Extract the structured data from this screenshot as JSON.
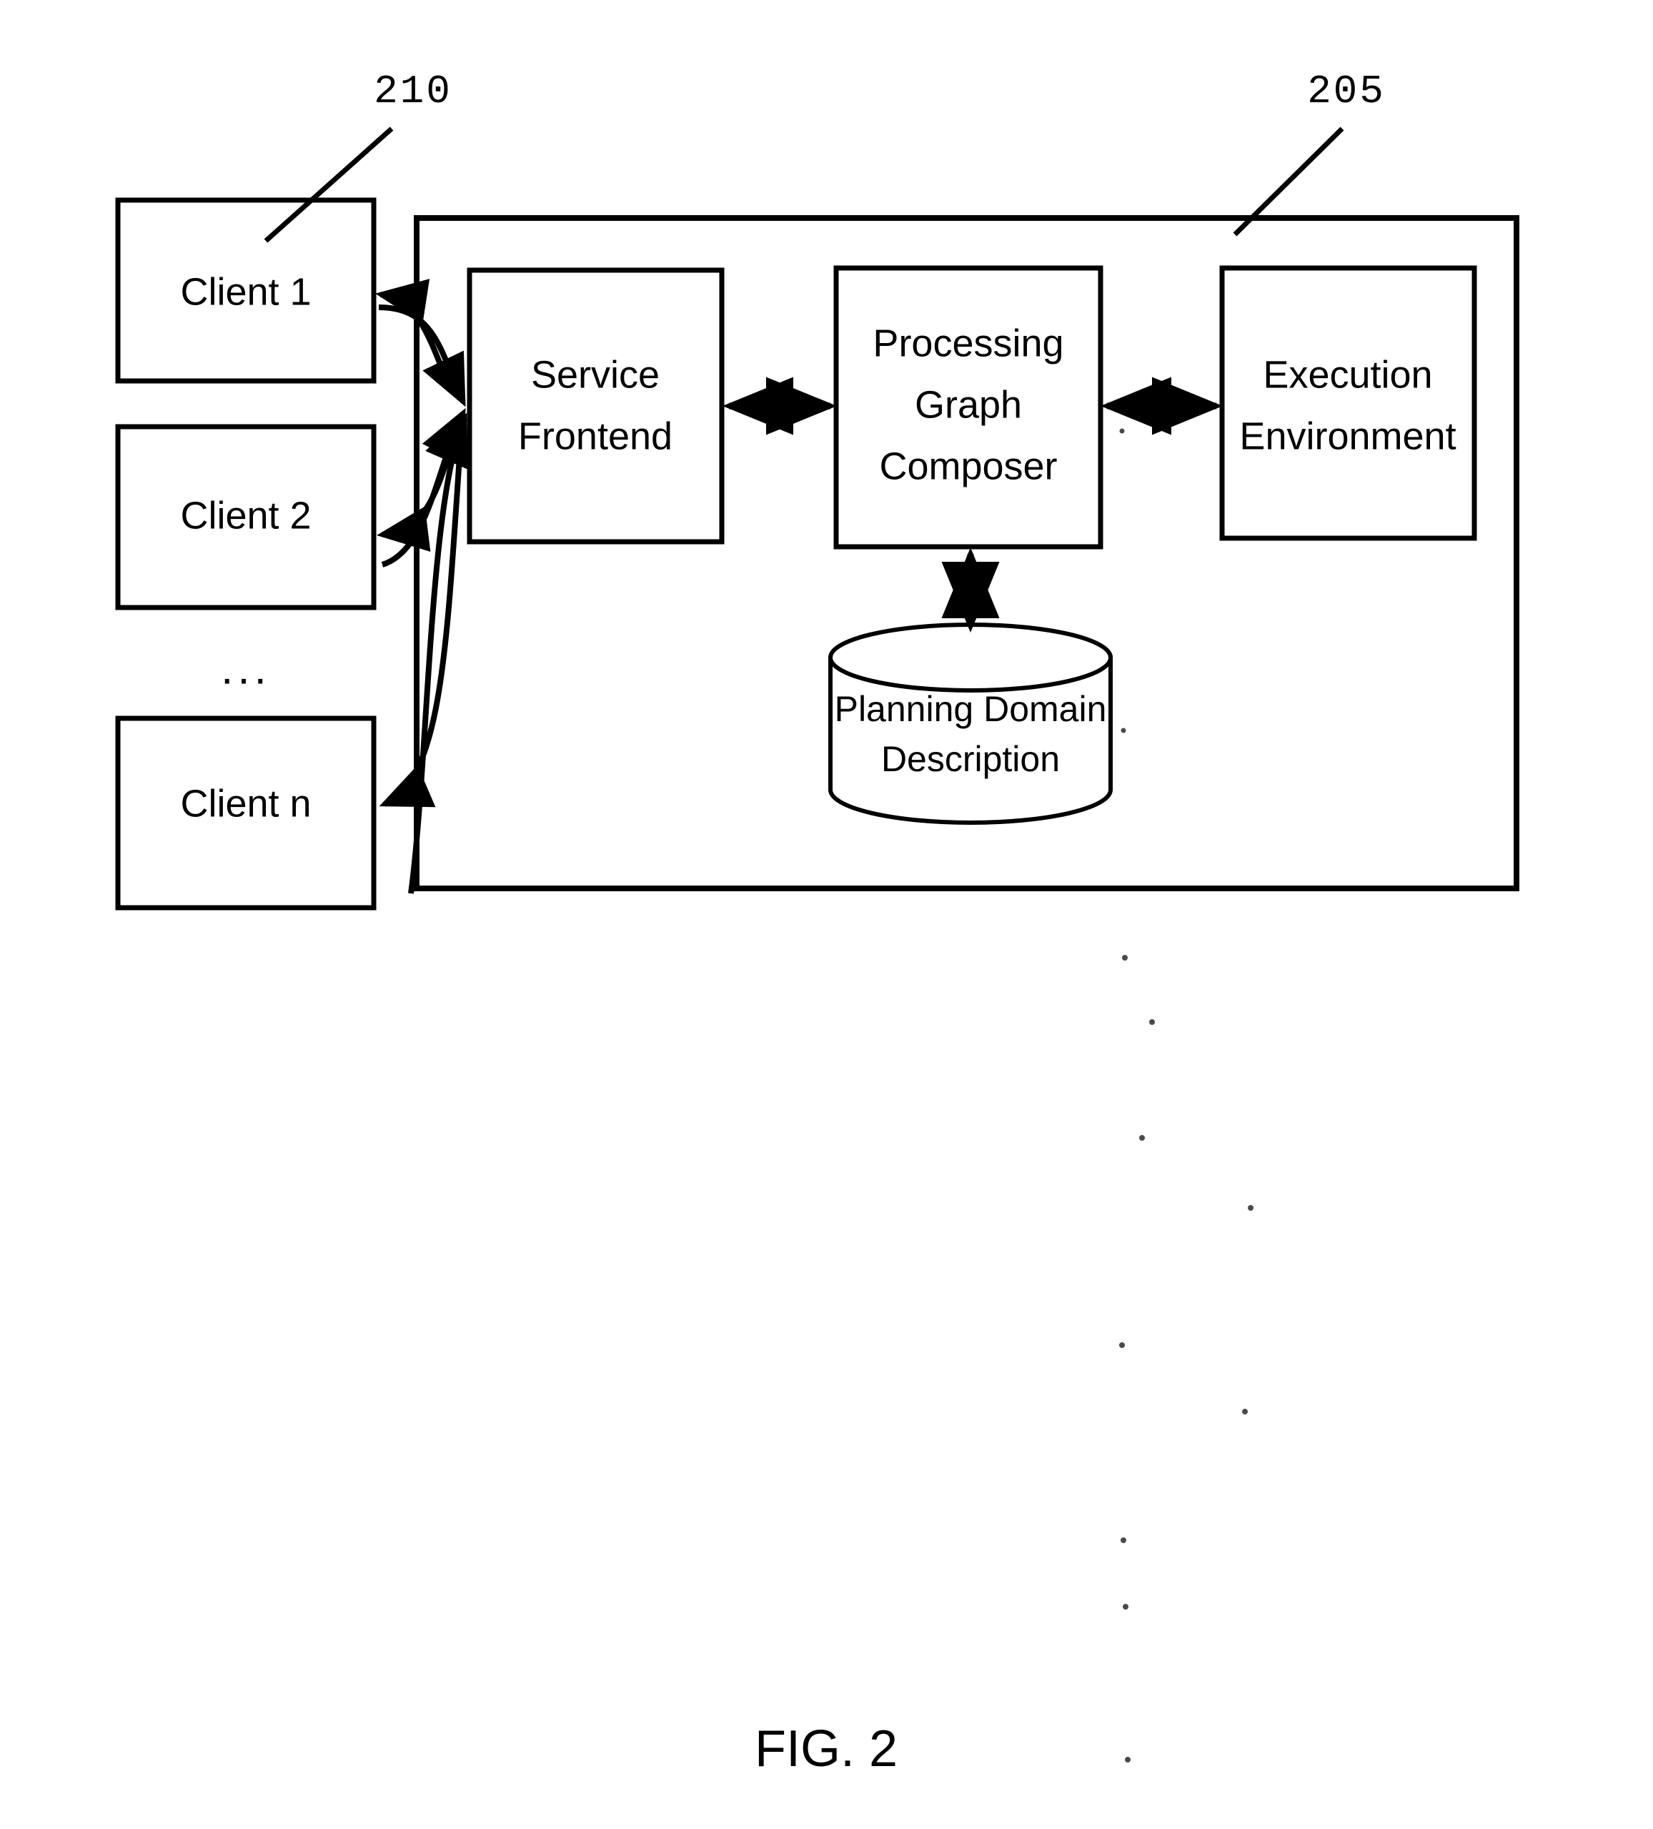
{
  "figure": {
    "caption": "FIG. 2",
    "reference_numerals": [
      {
        "id": "ref-210",
        "value": "210",
        "points_to": "client-1-box"
      },
      {
        "id": "ref-205",
        "value": "205",
        "points_to": "system-container"
      }
    ]
  },
  "clients": {
    "ellipsis": "...",
    "items": [
      {
        "id": "client-1",
        "label": "Client 1"
      },
      {
        "id": "client-2",
        "label": "Client 2"
      },
      {
        "id": "client-n",
        "label": "Client n"
      }
    ]
  },
  "system": {
    "blocks": [
      {
        "id": "service-frontend",
        "line1": "Service",
        "line2": "Frontend"
      },
      {
        "id": "processing-graph-composer",
        "line1": "Processing",
        "line2": "Graph",
        "line3": "Composer"
      },
      {
        "id": "execution-environment",
        "line1": "Execution",
        "line2": "Environment"
      }
    ],
    "datastore": {
      "id": "planning-domain-description",
      "line1": "Planning Domain",
      "line2": "Description"
    }
  },
  "colors": {
    "stroke": "#000000",
    "fill": "#ffffff",
    "background": "#ffffff"
  }
}
